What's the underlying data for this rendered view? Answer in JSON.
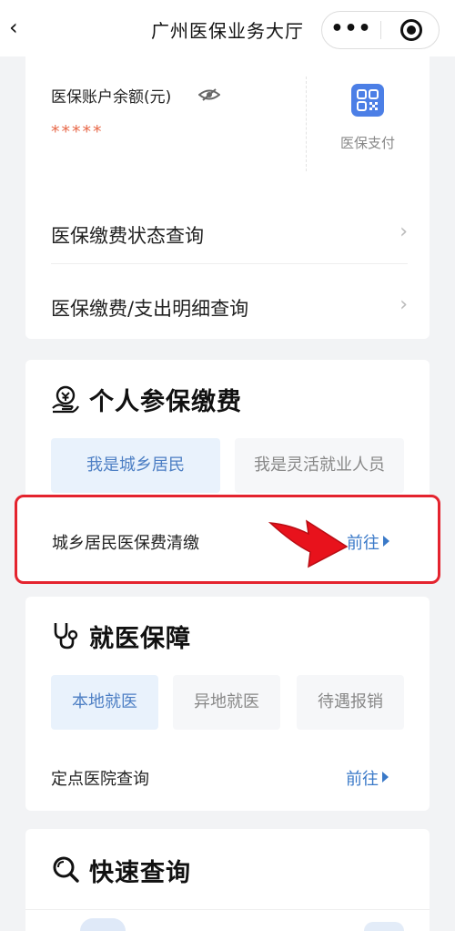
{
  "navbar": {
    "back_glyph": "‹",
    "title": "广州医保业务大厅",
    "more_glyph": "•••"
  },
  "account": {
    "balance_label": "医保账户余额(元)",
    "balance_masked": "*****",
    "pay_label": "医保支付",
    "rows": [
      {
        "label": "医保缴费状态查询",
        "chevron": "›"
      },
      {
        "label": "医保缴费/支出明细查询",
        "chevron": "›"
      }
    ]
  },
  "personal": {
    "title": "个人参保缴费",
    "tabs": [
      {
        "label": "我是城乡居民",
        "active": true
      },
      {
        "label": "我是灵活就业人员",
        "active": false
      }
    ],
    "item": {
      "label": "城乡居民医保费清缴",
      "action": "前往"
    }
  },
  "medical": {
    "title": "就医保障",
    "tabs": [
      {
        "label": "本地就医",
        "active": true
      },
      {
        "label": "异地就医",
        "active": false
      },
      {
        "label": "待遇报销",
        "active": false
      }
    ],
    "item": {
      "label": "定点医院查询",
      "action": "前往"
    }
  },
  "quick": {
    "title": "快速查询"
  },
  "colors": {
    "accent_blue": "#3a79c8",
    "active_tab_bg": "#e9f2fc",
    "highlight_red": "#e4232e",
    "star_orange": "#e8694a"
  },
  "icons": [
    "chevron-left-icon",
    "more-dots-icon",
    "close-target-icon",
    "eye-hidden-icon",
    "qr-code-icon",
    "hand-coin-icon",
    "stethoscope-icon",
    "search-icon",
    "red-arrow-icon"
  ]
}
